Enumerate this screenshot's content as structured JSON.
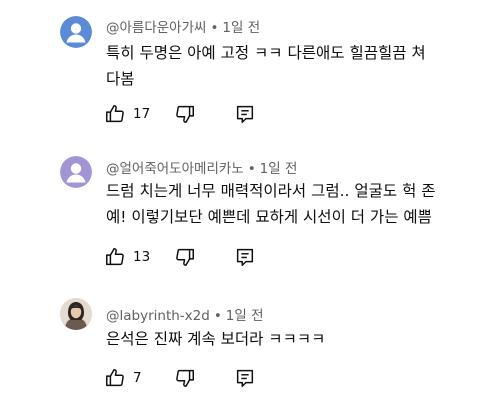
{
  "comments": [
    {
      "author": "@아름다운아가씨",
      "time": "1일 전",
      "text_lines": [
        "특히 두명은 아예 고정 ㅋㅋ 다른애도 힐끔힐끔 쳐",
        "다봄"
      ],
      "likes": "17",
      "avatar": "default-user-icon",
      "avatar_bg": "#5b8bd6"
    },
    {
      "author": "@얼어죽어도아메리카노",
      "time": "1일 전",
      "text_lines": [
        "드럼 치는게 너무 매력적이라서 그럼.. 얼굴도 헉 존",
        "예! 이렇기보단 예쁜데 묘하게 시선이 더 가는 예쁨"
      ],
      "likes": "13",
      "avatar": "default-user-icon",
      "avatar_bg": "#a395d4"
    },
    {
      "author": "@labyrinth-x2d",
      "time": "1일 전",
      "text_lines": [
        "은석은 진짜 계속 보더라 ㅋㅋㅋㅋ"
      ],
      "likes": "7",
      "avatar": "profile-photo"
    }
  ],
  "separator": "•",
  "icons": {
    "like": "thumbs-up-icon",
    "dislike": "thumbs-down-icon",
    "reply": "reply-comment-icon"
  }
}
